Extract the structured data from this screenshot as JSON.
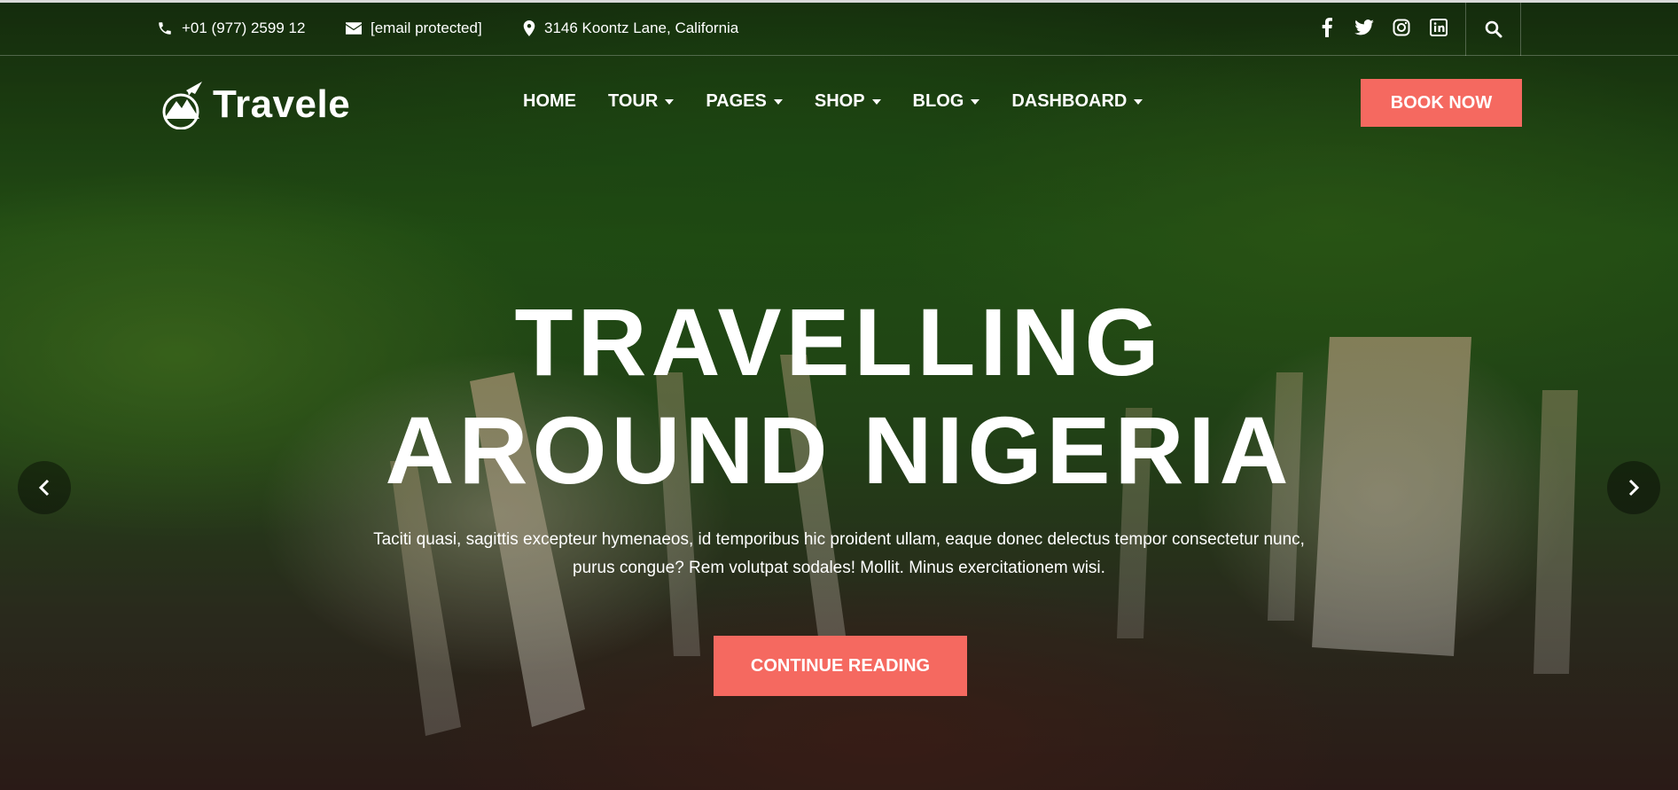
{
  "topbar": {
    "phone": "+01 (977) 2599 12",
    "email": "[email protected]",
    "address": "3146 Koontz Lane, California",
    "socials": [
      "facebook-icon",
      "twitter-icon",
      "instagram-icon",
      "linkedin-icon"
    ],
    "search_icon": "search-icon"
  },
  "logo": {
    "text": "Travele"
  },
  "nav": {
    "items": [
      {
        "label": "HOME",
        "dropdown": false
      },
      {
        "label": "TOUR",
        "dropdown": true
      },
      {
        "label": "PAGES",
        "dropdown": true
      },
      {
        "label": "SHOP",
        "dropdown": true
      },
      {
        "label": "BLOG",
        "dropdown": true
      },
      {
        "label": "DASHBOARD",
        "dropdown": true
      }
    ],
    "book_label": "BOOK NOW"
  },
  "hero": {
    "title_line1": "TRAVELLING",
    "title_line2": "AROUND NIGERIA",
    "text_line1": "Taciti quasi, sagittis excepteur hymenaeos, id temporibus hic proident ullam, eaque donec delectus tempor consectetur nunc,",
    "text_line2": "purus congue? Rem volutpat sodales! Mollit. Minus exercitationem wisi.",
    "cta_label": "CONTINUE READING"
  },
  "colors": {
    "accent": "#f56960",
    "text": "#ffffff"
  }
}
